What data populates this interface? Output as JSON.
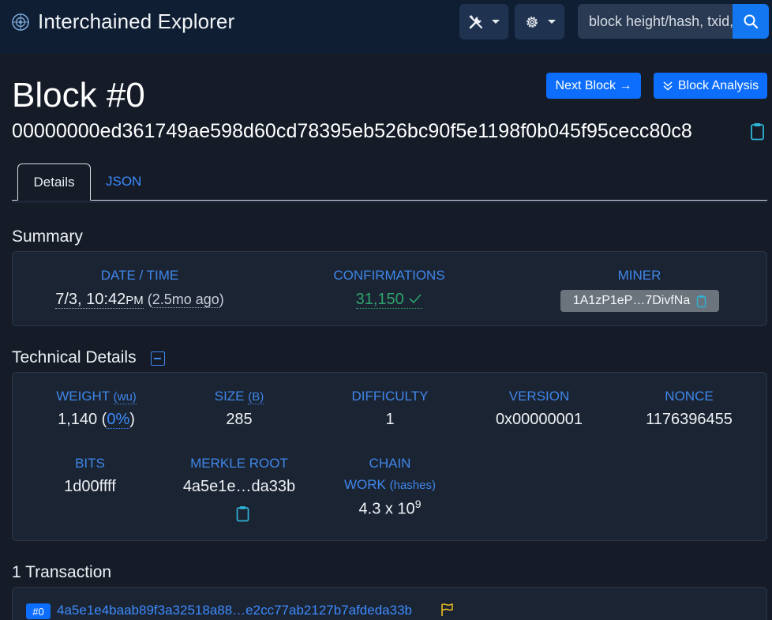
{
  "navbar": {
    "title": "Interchained Explorer",
    "search_placeholder": "block height/hash, txid, address"
  },
  "header": {
    "title": "Block #0",
    "hash": "00000000ed361749ae598d60cd78395eb526bc90f5e1198f0b045f95cecc80c8",
    "next_block_label": "Next Block →",
    "block_analysis_label": "Block Analysis"
  },
  "tabs": {
    "details": "Details",
    "json": "JSON"
  },
  "summary": {
    "title": "Summary",
    "date_label": "DATE / TIME",
    "date_value": "7/3, 10:42",
    "date_ampm": "PM",
    "date_paren_open": " (",
    "date_ago": "2.5mo ago",
    "date_paren_close": ")",
    "confirmations_label": "CONFIRMATIONS",
    "confirmations_value": "31,150",
    "miner_label": "MINER",
    "miner_value": "1A1zP1eP…7DivfNa"
  },
  "technical": {
    "title": "Technical Details",
    "weight_label": "WEIGHT",
    "weight_unit": "(wu)",
    "weight_value": "1,140",
    "weight_pct_open": " (",
    "weight_pct": "0%",
    "weight_pct_close": ")",
    "size_label": "SIZE",
    "size_unit": "(B)",
    "size_value": "285",
    "difficulty_label": "DIFFICULTY",
    "difficulty_value": "1",
    "version_label": "VERSION",
    "version_value": "0x00000001",
    "nonce_label": "NONCE",
    "nonce_value": "1176396455",
    "bits_label": "BITS",
    "bits_value": "1d00ffff",
    "merkle_label": "MERKLE ROOT",
    "merkle_value": "4a5e1e…da33b",
    "chain_label_1": "CHAIN",
    "chain_label_2": "WORK",
    "chain_unit": "(hashes)",
    "chain_value": "4.3 x 10",
    "chain_exp": "9"
  },
  "transactions": {
    "title": "1 Transaction",
    "items": [
      {
        "index": "#0",
        "txid": "4a5e1e4baab89f3a32518a88…e2cc77ab2127b7afdeda33b"
      }
    ]
  },
  "colors": {
    "accent": "#0d6efd",
    "label_blue": "#3f87ea",
    "success": "#2fa36b",
    "background": "#151c28",
    "card": "#1b2433"
  }
}
